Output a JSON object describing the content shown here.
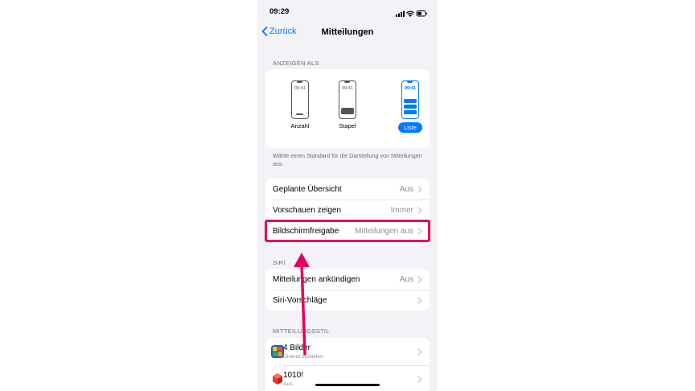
{
  "status_bar": {
    "time": "09:29"
  },
  "nav": {
    "back_label": "Zurück",
    "title": "Mitteilungen"
  },
  "display_section": {
    "header": "ANZEIGEN ALS",
    "options": [
      {
        "clock": "09:41",
        "label": "Anzahl"
      },
      {
        "clock": "09:41",
        "label": "Stapel"
      },
      {
        "clock": "09:41",
        "label": "Liste",
        "selected": true
      }
    ],
    "footer": "Wähle einen Standard für die Darstellung von Mitteilungen aus."
  },
  "settings_group": [
    {
      "label": "Geplante Übersicht",
      "value": "Aus"
    },
    {
      "label": "Vorschauen zeigen",
      "value": "Immer"
    },
    {
      "label": "Bildschirmfreigabe",
      "value": "Mitteilungen aus"
    }
  ],
  "siri_section": {
    "header": "SIRI",
    "rows": [
      {
        "label": "Mitteilungen ankündigen",
        "value": "Aus"
      },
      {
        "label": "Siri-Vorschläge",
        "value": ""
      }
    ]
  },
  "style_section": {
    "header": "MITTEILUNGSSTIL",
    "apps": [
      {
        "name": "4 Bilder",
        "subtitle": "Diskret zustellen"
      },
      {
        "name": "1010!",
        "subtitle": "Aus"
      }
    ]
  },
  "colors": {
    "accent": "#007aff",
    "highlight": "#e5005f",
    "background": "#f2f2f7"
  }
}
